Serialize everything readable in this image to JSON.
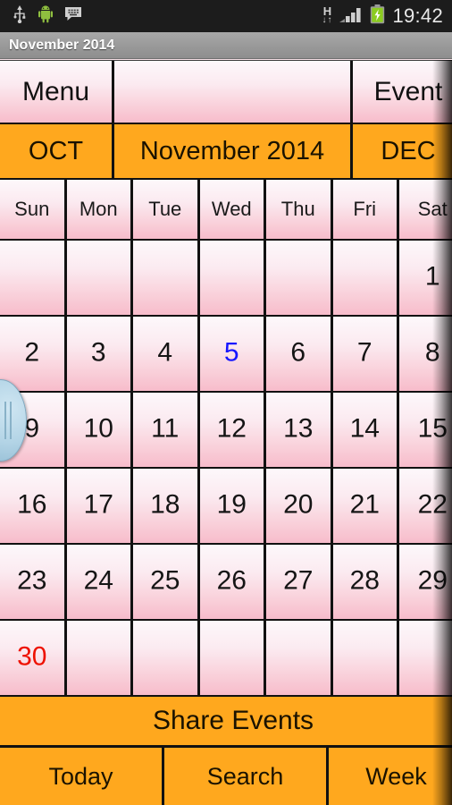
{
  "statusbar": {
    "icons": [
      "usb-icon",
      "android-robot-icon",
      "messaging-icon"
    ],
    "network_type": "H",
    "network_arrows": "↓↑",
    "signal": "signal-bars-icon",
    "battery": "battery-charging-icon",
    "clock": "19:42"
  },
  "titlebar": {
    "title": "November 2014"
  },
  "toolbar": {
    "menu_label": "Menu",
    "center_label": "",
    "event_label": "Event"
  },
  "month_nav": {
    "prev_label": "OCT",
    "title": "November 2014",
    "next_label": "DEC"
  },
  "weekdays": [
    "Sun",
    "Mon",
    "Tue",
    "Wed",
    "Thu",
    "Fri",
    "Sat"
  ],
  "calendar": {
    "weeks": [
      [
        {
          "num": "",
          "style": "normal"
        },
        {
          "num": "",
          "style": "normal"
        },
        {
          "num": "",
          "style": "normal"
        },
        {
          "num": "",
          "style": "normal"
        },
        {
          "num": "",
          "style": "normal"
        },
        {
          "num": "",
          "style": "normal"
        },
        {
          "num": "1",
          "style": "normal"
        }
      ],
      [
        {
          "num": "2",
          "style": "normal"
        },
        {
          "num": "3",
          "style": "normal"
        },
        {
          "num": "4",
          "style": "normal"
        },
        {
          "num": "5",
          "style": "selected"
        },
        {
          "num": "6",
          "style": "normal"
        },
        {
          "num": "7",
          "style": "normal"
        },
        {
          "num": "8",
          "style": "normal"
        }
      ],
      [
        {
          "num": "9",
          "style": "normal"
        },
        {
          "num": "10",
          "style": "normal"
        },
        {
          "num": "11",
          "style": "normal"
        },
        {
          "num": "12",
          "style": "normal"
        },
        {
          "num": "13",
          "style": "normal"
        },
        {
          "num": "14",
          "style": "normal"
        },
        {
          "num": "15",
          "style": "normal"
        }
      ],
      [
        {
          "num": "16",
          "style": "normal"
        },
        {
          "num": "17",
          "style": "normal"
        },
        {
          "num": "18",
          "style": "normal"
        },
        {
          "num": "19",
          "style": "normal"
        },
        {
          "num": "20",
          "style": "normal"
        },
        {
          "num": "21",
          "style": "normal"
        },
        {
          "num": "22",
          "style": "normal"
        }
      ],
      [
        {
          "num": "23",
          "style": "normal"
        },
        {
          "num": "24",
          "style": "normal"
        },
        {
          "num": "25",
          "style": "normal"
        },
        {
          "num": "26",
          "style": "normal"
        },
        {
          "num": "27",
          "style": "normal"
        },
        {
          "num": "28",
          "style": "normal"
        },
        {
          "num": "29",
          "style": "normal"
        }
      ],
      [
        {
          "num": "30",
          "style": "holiday"
        },
        {
          "num": "",
          "style": "normal"
        },
        {
          "num": "",
          "style": "normal"
        },
        {
          "num": "",
          "style": "normal"
        },
        {
          "num": "",
          "style": "normal"
        },
        {
          "num": "",
          "style": "normal"
        },
        {
          "num": "",
          "style": "normal"
        }
      ]
    ]
  },
  "share": {
    "label": "Share Events"
  },
  "bottombar": {
    "today_label": "Today",
    "search_label": "Search",
    "week_label": "Week"
  },
  "colors": {
    "accent_orange": "#ffa81e",
    "cell_pink_top": "#fdf8fb",
    "cell_pink_bottom": "#f7bccb",
    "selected_day": "#1515ff",
    "holiday_day": "#ee1100",
    "titlebar_gray": "#9a9a9a",
    "handle_blue": "#b3d4e6"
  }
}
